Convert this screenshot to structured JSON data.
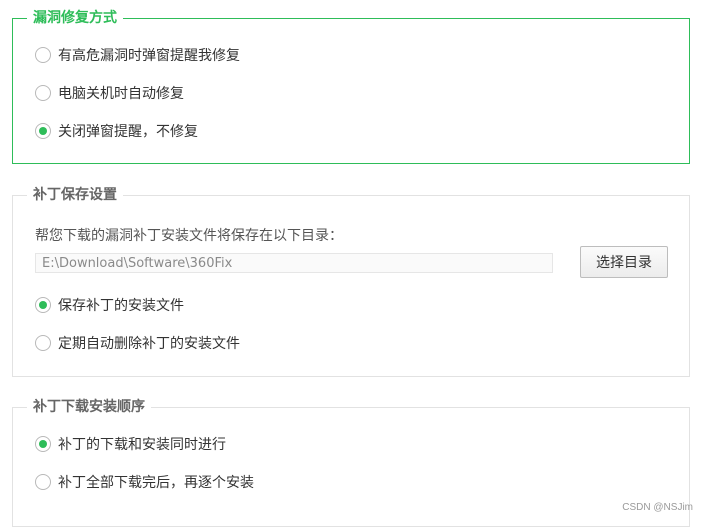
{
  "repair_mode": {
    "legend": "漏洞修复方式",
    "options": [
      {
        "label": "有高危漏洞时弹窗提醒我修复",
        "checked": false
      },
      {
        "label": "电脑关机时自动修复",
        "checked": false
      },
      {
        "label": "关闭弹窗提醒，不修复",
        "checked": true
      }
    ]
  },
  "patch_save": {
    "legend": "补丁保存设置",
    "description": "帮您下载的漏洞补丁安装文件将保存在以下目录：",
    "path_value": "E:\\Download\\Software\\360Fix",
    "browse_label": "选择目录",
    "options": [
      {
        "label": "保存补丁的安装文件",
        "checked": true
      },
      {
        "label": "定期自动删除补丁的安装文件",
        "checked": false
      }
    ]
  },
  "install_order": {
    "legend": "补丁下载安装顺序",
    "options": [
      {
        "label": "补丁的下载和安装同时进行",
        "checked": true
      },
      {
        "label": "补丁全部下载完后，再逐个安装",
        "checked": false
      }
    ]
  },
  "accent_color": "#2ebd59",
  "watermark": "CSDN @NSJim"
}
